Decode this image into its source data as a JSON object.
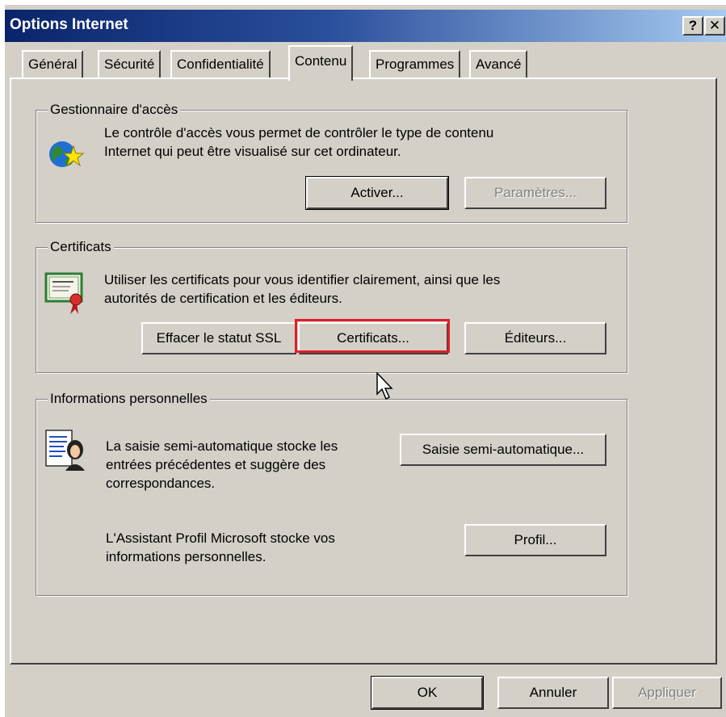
{
  "window": {
    "title": "Options Internet",
    "help_label": "?",
    "close_label": "✕"
  },
  "tabs": [
    {
      "label": "Général",
      "active": false
    },
    {
      "label": "Sécurité",
      "active": false
    },
    {
      "label": "Confidentialité",
      "active": false
    },
    {
      "label": "Contenu",
      "active": true
    },
    {
      "label": "Programmes",
      "active": false
    },
    {
      "label": "Avancé",
      "active": false
    }
  ],
  "content_advisor": {
    "label": "Gestionnaire d'accès",
    "line1": "Le contrôle d'accès vous permet de contrôler le type de contenu",
    "line2": "Internet qui peut être visualisé sur cet ordinateur.",
    "enable_button": "Activer...",
    "settings_button": "Paramètres...",
    "icon": "globe-star-icon"
  },
  "certificates": {
    "label": "Certificats",
    "line1": "Utiliser les certificats pour vous identifier clairement, ainsi que les",
    "line2": "autorités de certification et les éditeurs.",
    "clear_ssl_button": "Effacer le statut SSL",
    "certificates_button": "Certificats...",
    "publishers_button": "Éditeurs...",
    "icon": "certificate-icon"
  },
  "personal_info": {
    "label": "Informations personnelles",
    "autocomplete_line1": "La saisie semi-automatique stocke les",
    "autocomplete_line2": "entrées précédentes et suggère des",
    "autocomplete_line3": "correspondances.",
    "autocomplete_button": "Saisie semi-automatique...",
    "profile_line1": "L'Assistant Profil Microsoft stocke vos",
    "profile_line2": "informations personnelles.",
    "profile_button": "Profil...",
    "icon": "profile-icon"
  },
  "footer": {
    "ok_button": "OK",
    "cancel_button": "Annuler",
    "apply_button": "Appliquer"
  },
  "colors": {
    "highlight": "#e01e26",
    "dialog_bg": "#d4d0c8",
    "title_bar": "#0a246a"
  }
}
